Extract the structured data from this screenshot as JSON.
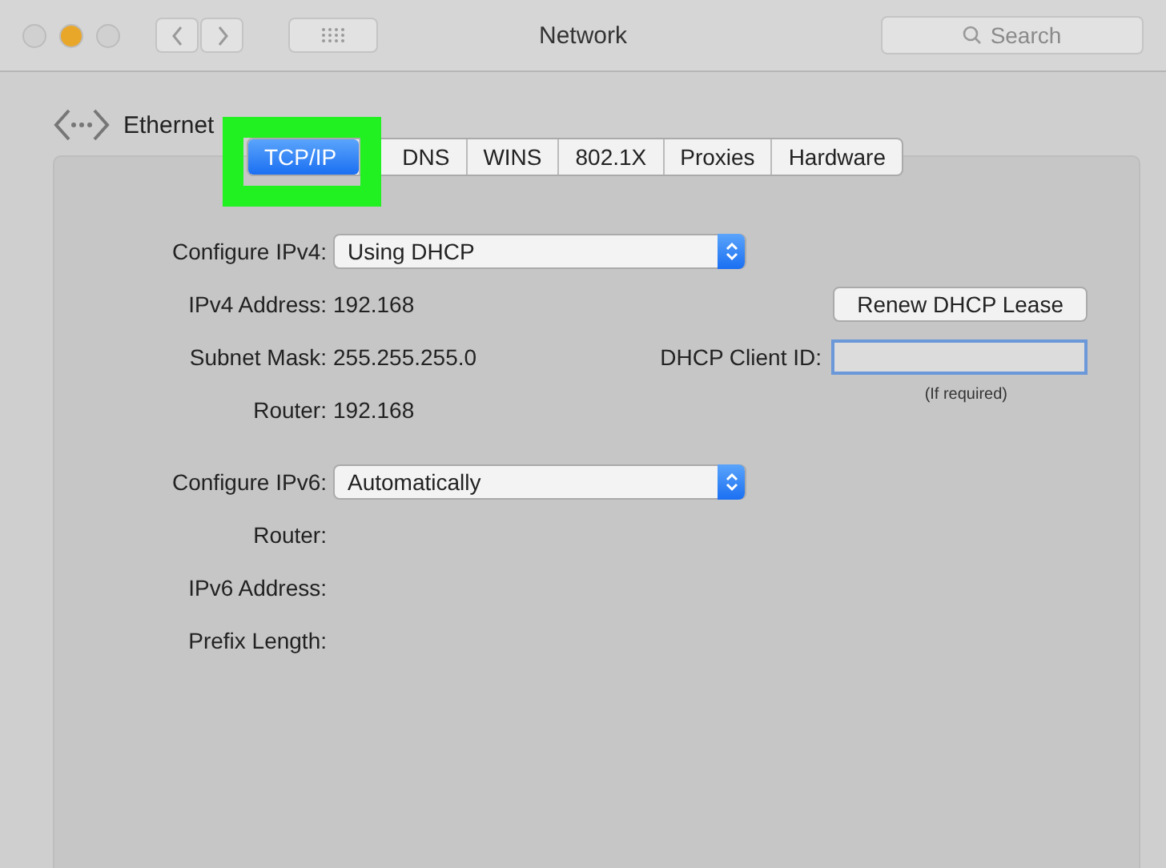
{
  "window": {
    "title": "Network",
    "search": {
      "placeholder": "Search"
    }
  },
  "service": {
    "name": "Ethernet"
  },
  "highlight": {
    "on": true
  },
  "tabs": [
    {
      "label": "TCP/IP",
      "selected": true
    },
    {
      "label": "DNS",
      "selected": false
    },
    {
      "label": "WINS",
      "selected": false
    },
    {
      "label": "802.1X",
      "selected": false
    },
    {
      "label": "Proxies",
      "selected": false
    },
    {
      "label": "Hardware",
      "selected": false
    }
  ],
  "ipv4": {
    "configure_label": "Configure IPv4:",
    "configure_value": "Using DHCP",
    "rows": [
      {
        "label": "IPv4 Address:",
        "value": "192.168"
      },
      {
        "label": "Subnet Mask:",
        "value": "255.255.255.0"
      },
      {
        "label": "Router:",
        "value": "192.168"
      }
    ],
    "renew_button": "Renew DHCP Lease",
    "client_id_label": "DHCP Client ID:",
    "client_id_hint": "(If required)"
  },
  "ipv6": {
    "configure_label": "Configure IPv6:",
    "configure_value": "Automatically",
    "rows": [
      {
        "label": "Router:"
      },
      {
        "label": "IPv6 Address:"
      },
      {
        "label": "Prefix Length:"
      }
    ]
  }
}
